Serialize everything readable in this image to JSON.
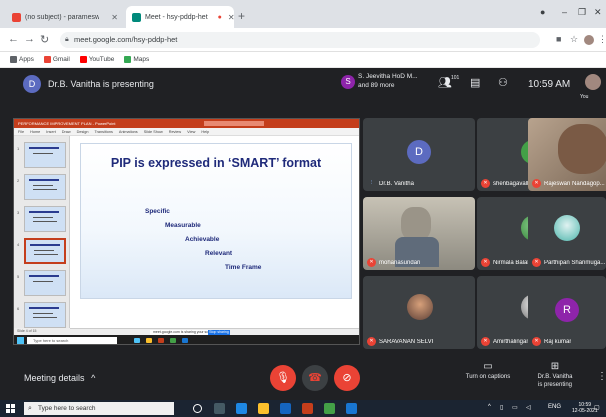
{
  "browser": {
    "tabs": [
      {
        "label": "(no subject) - parameswarikanag",
        "favicon_color": "#ea4335",
        "active": false
      },
      {
        "label": "Meet - hsy-pddp-het",
        "favicon_color": "#00897b",
        "active": true
      }
    ],
    "address": "meet.google.com/hsy-pddp-het",
    "bookmarks": [
      {
        "label": "Apps",
        "icon": "apps-grid-icon",
        "color": "#5f6368"
      },
      {
        "label": "Gmail",
        "icon": "gmail-icon",
        "color": "#ea4335"
      },
      {
        "label": "YouTube",
        "icon": "youtube-icon",
        "color": "#ff0000"
      },
      {
        "label": "Maps",
        "icon": "maps-icon",
        "color": "#34a853"
      }
    ]
  },
  "meet_header": {
    "presenter_initial": "D",
    "presenting_text": "Dr.B. Vanitha is presenting",
    "attendee_initial": "S",
    "attendee_line1": "S. Jeevitha HoD M...",
    "attendee_line2": "and 89 more",
    "people_count": "101",
    "time": "10:59 AM",
    "you_label": "You"
  },
  "shared_screen": {
    "ppt_window_title": "PERFORMANCE IMPROVEMENT PLAN - PowerPoint",
    "ppt_menu": [
      "File",
      "Home",
      "Insert",
      "Draw",
      "Design",
      "Transitions",
      "Animations",
      "Slide Show",
      "Review",
      "View",
      "Help"
    ],
    "slide_title": "PIP is expressed in ‘SMART’ format",
    "smart_items": [
      "Specific",
      "Measurable",
      "Achievable",
      "Relevant",
      "Time Frame"
    ],
    "notes_chip": "meet.google.com is sharing your screen",
    "notes_button": "Stop sharing",
    "status_text": "Slide 4 of 15",
    "taskbar_search": "Type here to search"
  },
  "participants": [
    {
      "name": "Dr.B. Vanitha",
      "initial": "D",
      "color": "#5c6bc0",
      "muted": false,
      "kind": "avatar"
    },
    {
      "name": "shenbagavalli sivalin...",
      "initial": "S",
      "color": "#43a047",
      "muted": true,
      "kind": "avatar"
    },
    {
      "name": "Rajeswari Nandagop...",
      "initial": "",
      "color": "#8d6e63",
      "muted": true,
      "kind": "video"
    },
    {
      "name": "mohanasundari",
      "initial": "",
      "color": "#6d7a6a",
      "muted": true,
      "kind": "video"
    },
    {
      "name": "Nirmala Balakrishnan",
      "initial": "",
      "color": "#2e7d32",
      "muted": true,
      "kind": "photo"
    },
    {
      "name": "Parthipan Shanmuga...",
      "initial": "",
      "color": "#4db6ac",
      "muted": true,
      "kind": "photo"
    },
    {
      "name": "SARAVANAN SELVI",
      "initial": "",
      "color": "#795548",
      "muted": true,
      "kind": "photo"
    },
    {
      "name": "Amirthalingam Ramji",
      "initial": "",
      "color": "#9e9e9e",
      "muted": true,
      "kind": "photo"
    },
    {
      "name": "Raj kumar",
      "initial": "R",
      "color": "#8e24aa",
      "muted": true,
      "kind": "avatar"
    }
  ],
  "bottom_bar": {
    "meeting_details": "Meeting details",
    "captions_label": "Turn on captions",
    "presenting_label_1": "Dr.B. Vanitha",
    "presenting_label_2": "is presenting"
  },
  "taskbar": {
    "search_placeholder": "Type here to search",
    "lang": "ENG",
    "time": "10:59",
    "date": "12-05-2021"
  },
  "colors": {
    "meet_bg": "#202124",
    "tile_bg": "#3c4043",
    "end_call_red": "#ea4335",
    "slide_title_blue": "#1f2a7a"
  }
}
